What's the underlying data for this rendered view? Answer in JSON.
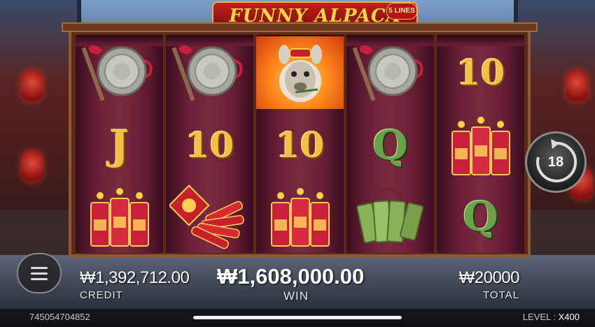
{
  "game": {
    "title": "FUNNY ALPACA",
    "lines_badge": "5 LINES"
  },
  "reels": [
    [
      "gong",
      "J",
      "firecrackers"
    ],
    [
      "gong",
      "10",
      "red-firecracker-bundle"
    ],
    [
      "alpaca",
      "10",
      "firecrackers"
    ],
    [
      "gong",
      "Q",
      "jade-tablets"
    ],
    [
      "10",
      "firecrackers",
      "Q"
    ]
  ],
  "symbol_text": {
    "J": "J",
    "10": "10",
    "Q": "Q"
  },
  "spin": {
    "count": "18",
    "icon": "auto-spin-arrow-icon"
  },
  "credit": {
    "value": "₩1,392,712.00",
    "label": "CREDIT"
  },
  "win": {
    "value": "₩1,608,000.00",
    "label": "WIN"
  },
  "total": {
    "value": "₩20000",
    "label": "TOTAL"
  },
  "footer": {
    "round_id": "745054704852",
    "level_label": "LEVEL : ",
    "level_value": "X400"
  },
  "colors": {
    "gold": "#f1c046",
    "green": "#6aa24a",
    "reel_bg": "#6a1f36"
  }
}
